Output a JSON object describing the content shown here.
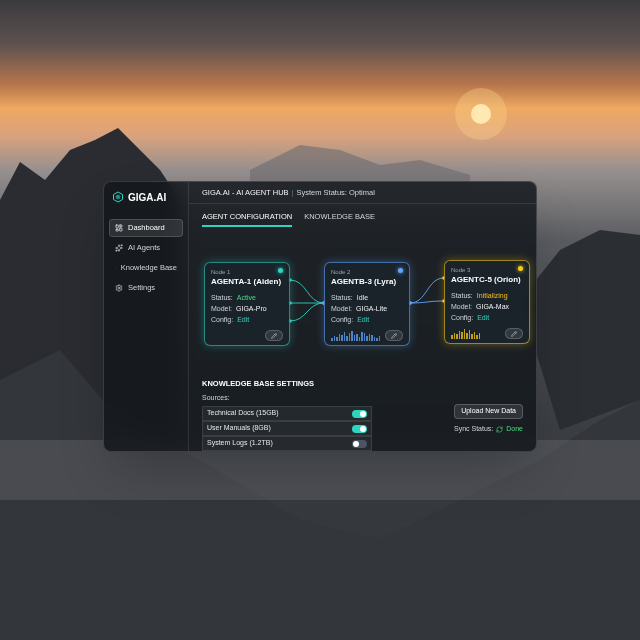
{
  "app": {
    "logo": "GIGA.AI"
  },
  "sidebar": {
    "items": [
      {
        "label": "Dashboard",
        "selected": true
      },
      {
        "label": "AI Agents",
        "selected": false
      },
      {
        "label": "Knowledge Base",
        "selected": false
      },
      {
        "label": "Settings",
        "selected": false
      }
    ]
  },
  "header": {
    "title": "GIGA.AI - AI AGENT HUB",
    "separator": "|",
    "status": "System Status: Optimal"
  },
  "tabs": [
    {
      "label": "AGENT CONFIGURATION",
      "selected": true
    },
    {
      "label": "KNOWLEDGE BASE",
      "selected": false
    }
  ],
  "nodes": [
    {
      "label": "Node 1",
      "name": "AGENTA-1 (Aiden)",
      "status_label": "Status:",
      "status": "Active",
      "status_color": "#4ade80",
      "model_label": "Model:",
      "model": "GIGA-Pro",
      "config_label": "Config:",
      "config": "Edit",
      "color": "#2dd4bf",
      "activity": []
    },
    {
      "label": "Node 2",
      "name": "AGENTB-3 (Lyra)",
      "status_label": "Status:",
      "status": "Idle",
      "status_color": "#e5e7eb",
      "model_label": "Model:",
      "model": "GIGA-Lite",
      "config_label": "Config:",
      "config": "Edit",
      "color": "#60a5fa",
      "activity": [
        0.3,
        0.5,
        0.4,
        0.7,
        0.6,
        0.9,
        0.5,
        0.8,
        1,
        0.6,
        0.7,
        0.4,
        0.9,
        0.8,
        0.5,
        0.7,
        0.6,
        0.4,
        0.3,
        0.5
      ]
    },
    {
      "label": "Node 3",
      "name": "AGENTC-5 (Orion)",
      "status_label": "Status:",
      "status": "Initializing",
      "status_color": "#fbbf24",
      "model_label": "Model:",
      "model": "GIGA-Max",
      "config_label": "Config:",
      "config": "Edit",
      "color": "#facc15",
      "activity": [
        0.4,
        0.6,
        0.5,
        0.8,
        0.7,
        1,
        0.6,
        0.9,
        0.5,
        0.7,
        0.4,
        0.6
      ]
    }
  ],
  "links": [
    {
      "from": 0,
      "out": 0,
      "to": 1,
      "in": 1
    },
    {
      "from": 0,
      "out": 1,
      "to": 1,
      "in": 1
    },
    {
      "from": 0,
      "out": 2,
      "to": 1,
      "in": 1
    },
    {
      "from": 1,
      "out": 1,
      "to": 2,
      "in": 0
    },
    {
      "from": 1,
      "out": 1,
      "to": 2,
      "in": 1
    }
  ],
  "knowledge_base": {
    "title": "KNOWLEDGE BASE SETTINGS",
    "sources_label": "Sources:",
    "sources": [
      {
        "label": "Technical Docs (15GB)",
        "on": true
      },
      {
        "label": "User Manuals (8GB)",
        "on": true
      },
      {
        "label": "System Logs (1.2TB)",
        "on": false
      }
    ],
    "upload_button": "Upload New Data",
    "sync_label": "Sync Status:",
    "sync_status": "Done"
  }
}
